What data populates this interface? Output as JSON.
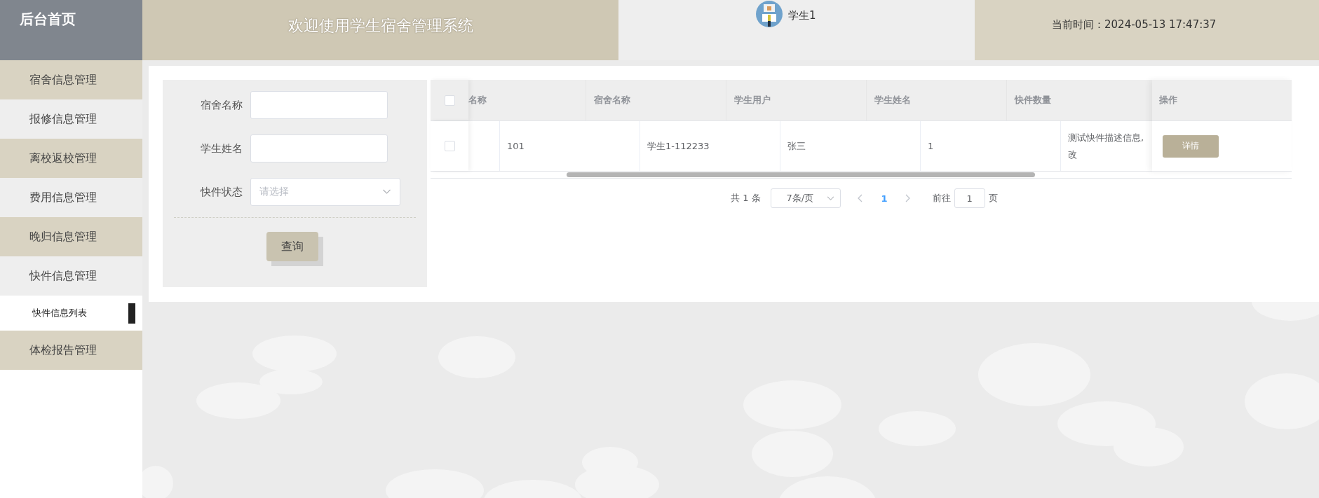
{
  "header": {
    "logo": "后台首页",
    "title": "欢迎使用学生宿舍管理系统",
    "user": "学生1",
    "clock": "当前时间：2024-05-13 17:47:37"
  },
  "sidebar": {
    "items": [
      {
        "label": "宿舍信息管理",
        "selected": false
      },
      {
        "label": "报修信息管理",
        "selected": false
      },
      {
        "label": "离校返校管理",
        "selected": false
      },
      {
        "label": "费用信息管理",
        "selected": false
      },
      {
        "label": "晚归信息管理",
        "selected": false
      },
      {
        "label": "快件信息管理",
        "selected": false,
        "children": [
          {
            "label": "快件信息列表",
            "selected": true
          }
        ]
      },
      {
        "label": "体检报告管理",
        "selected": false
      }
    ]
  },
  "search_form": {
    "fields": [
      {
        "label": "宿舍名称",
        "kind": "text"
      },
      {
        "label": "学生姓名",
        "kind": "text"
      },
      {
        "label": "快件状态",
        "kind": "select",
        "placeholder": "请选择"
      }
    ],
    "button": "查询"
  },
  "table": {
    "select_all": {
      "checked": false
    },
    "columns": [
      "名称",
      "宿舍名称",
      "学生用户",
      "学生姓名",
      "快件数量"
    ],
    "action_column": "操作",
    "rows": [
      {
        "checked": false,
        "cells": [
          "101",
          "学生1-112233",
          "张三",
          "1"
        ],
        "description_lines": [
          "测试快件描述信息,",
          "改"
        ],
        "action": "详情"
      }
    ]
  },
  "pagination": {
    "total": "共 1 条",
    "page_size": "7条/页",
    "pages": [
      {
        "label": "1",
        "selected": true
      }
    ],
    "goto_label": "前往",
    "goto_value": "1",
    "goto_suffix": "页"
  }
}
